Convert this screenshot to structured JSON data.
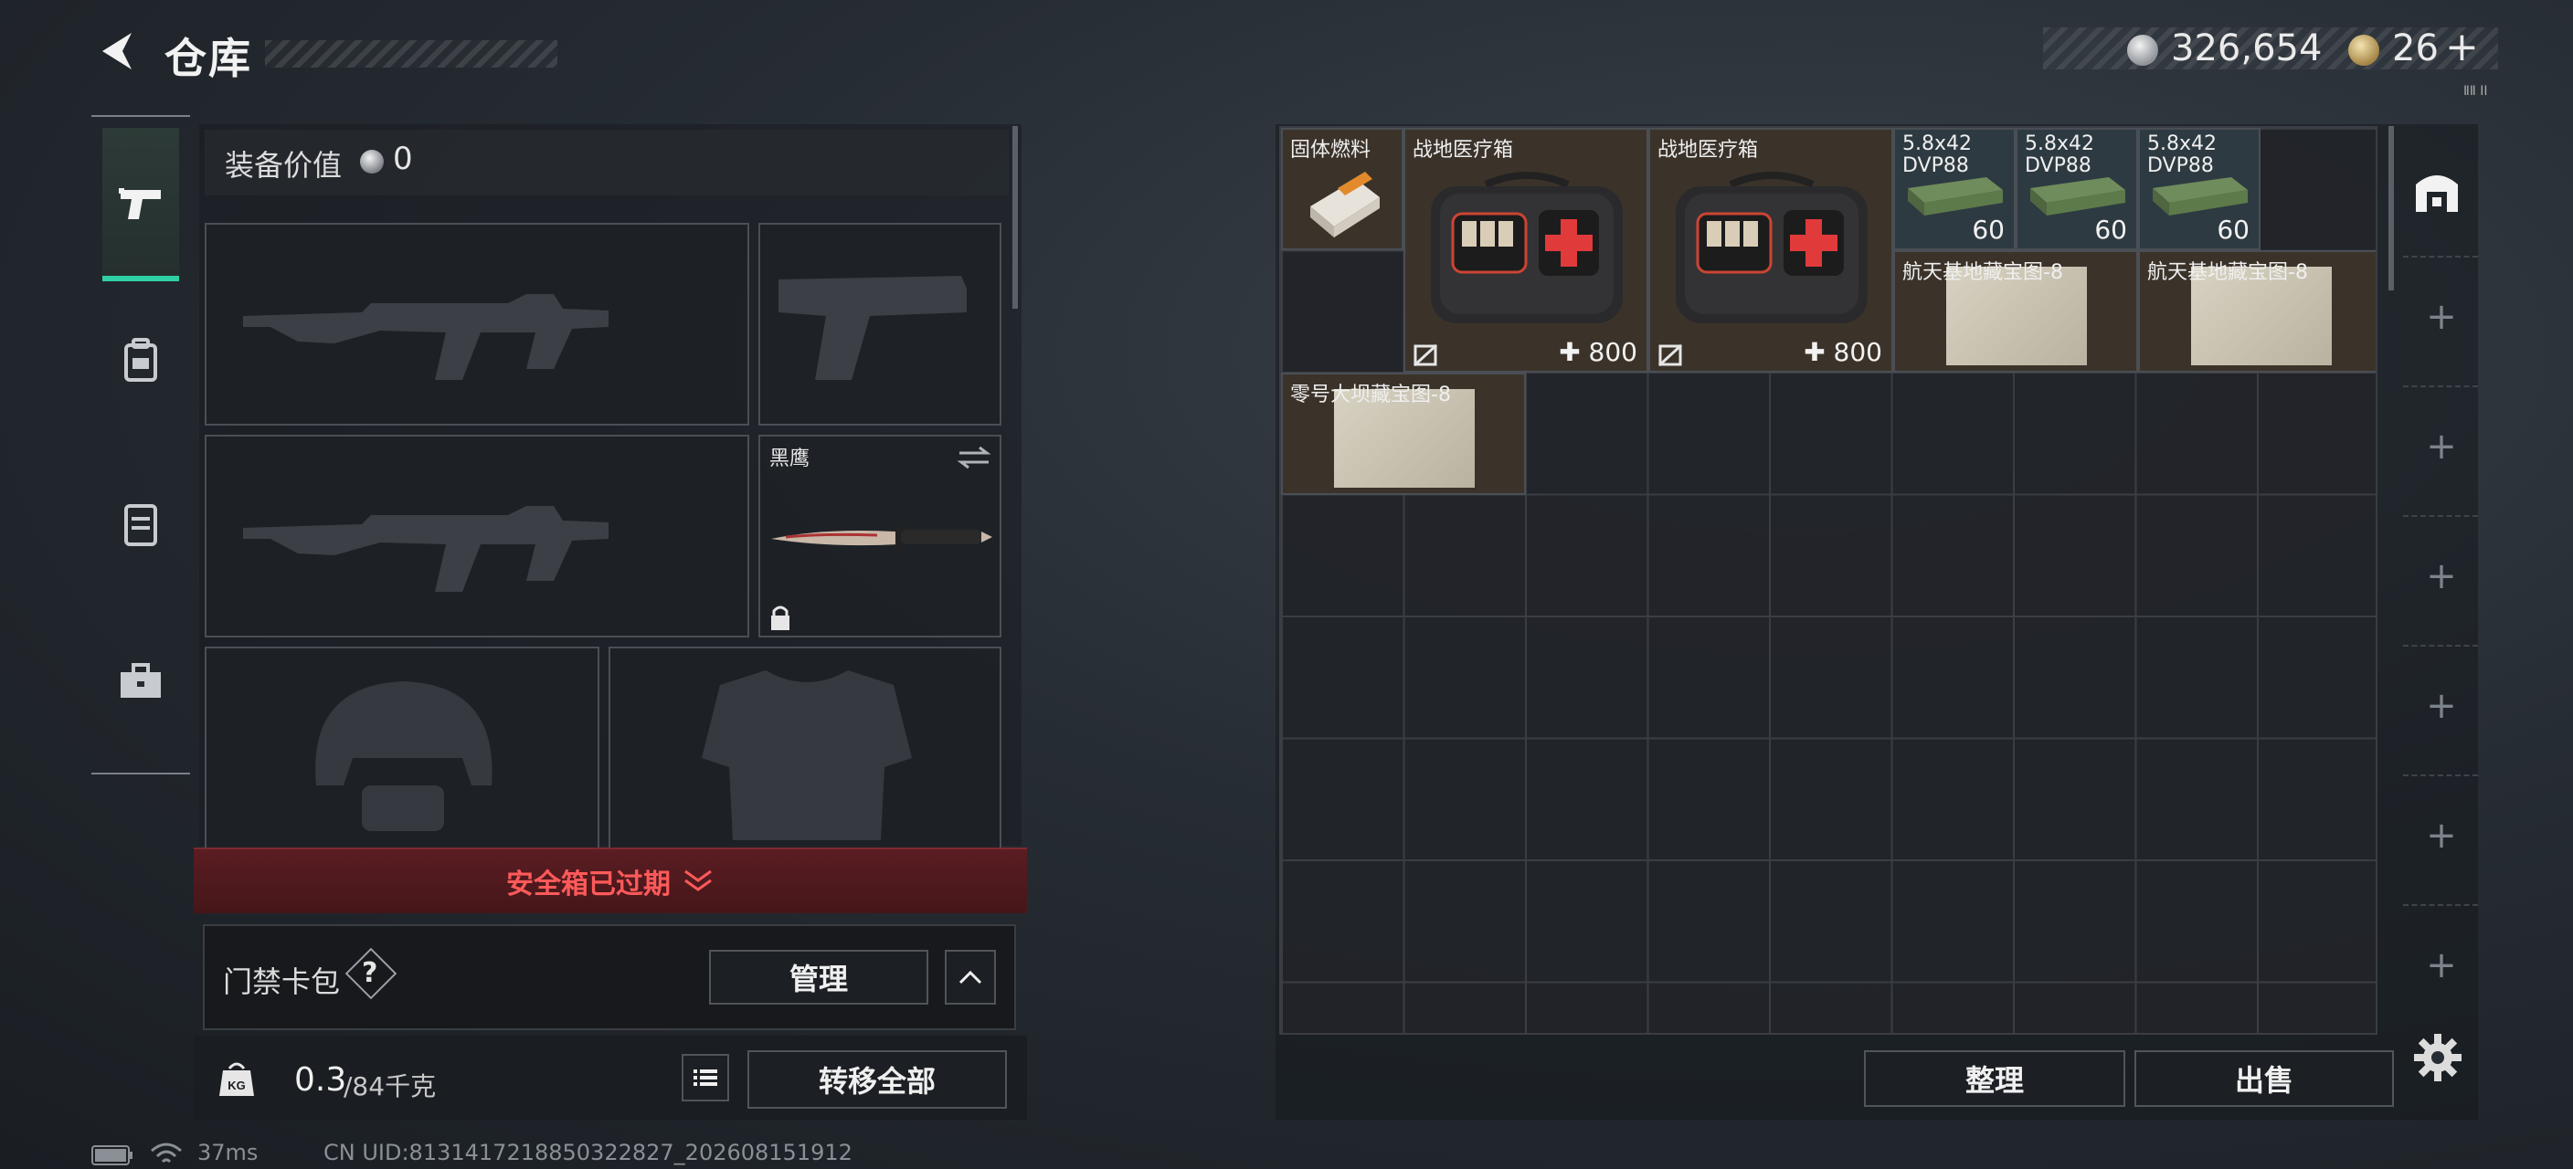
{
  "header": {
    "title": "仓库",
    "silver": "326,654",
    "gold": "26",
    "gold_plus": "+",
    "corner_tag": "ⅡⅡ ⅠⅠ"
  },
  "nav": {
    "items": [
      "weapon-tab",
      "backpack-tab",
      "armor-tab",
      "toolbox-tab"
    ],
    "active": "weapon-tab"
  },
  "equipment": {
    "value_label": "装备价值",
    "value": "0",
    "melee_name": "黑鹰"
  },
  "safebox": {
    "text": "安全箱已过期"
  },
  "keycard": {
    "label": "门禁卡包",
    "help": "?",
    "manage_label": "管理"
  },
  "weight": {
    "current": "0.3",
    "max": "/84千克",
    "transfer_label": "转移全部"
  },
  "status": {
    "ping": "37ms",
    "uid": "CN UID:8131417218850322827_202608151912"
  },
  "storage": {
    "items": [
      {
        "name": "固体燃料",
        "qty": ""
      },
      {
        "name": "战地医疗箱",
        "qty": "✚ 800"
      },
      {
        "name": "战地医疗箱",
        "qty": "✚ 800"
      },
      {
        "name": "5.8x42 DVP88",
        "qty": "60"
      },
      {
        "name": "5.8x42 DVP88",
        "qty": "60"
      },
      {
        "name": "5.8x42 DVP88",
        "qty": "60"
      },
      {
        "name": "航天基地藏宝图-8",
        "qty": ""
      },
      {
        "name": "航天基地藏宝图-8",
        "qty": ""
      },
      {
        "name": "零号大坝藏宝图-8",
        "qty": ""
      }
    ],
    "sort_label": "整理",
    "sell_label": "出售"
  }
}
